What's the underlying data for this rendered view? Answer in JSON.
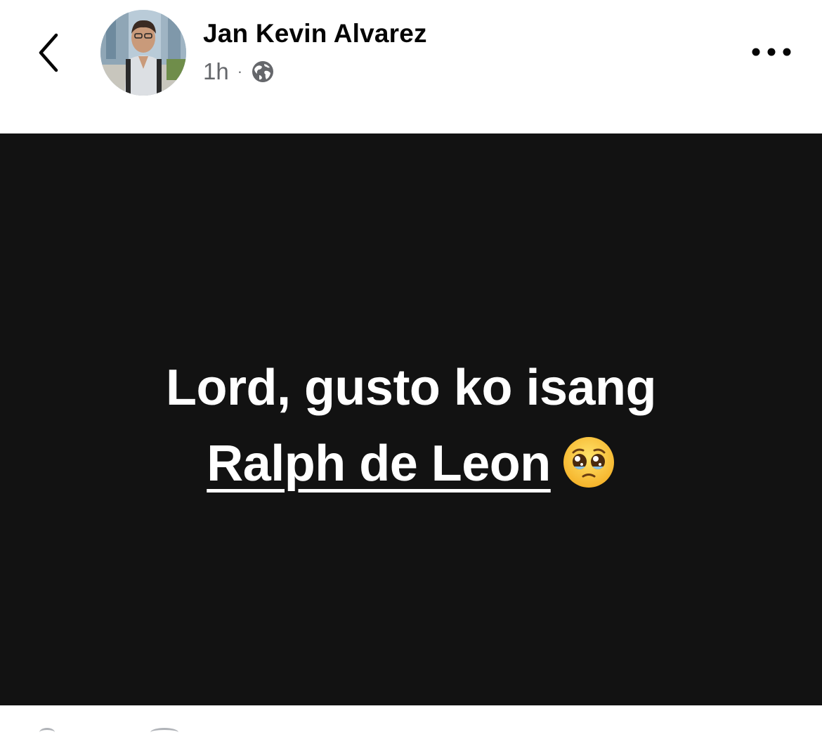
{
  "header": {
    "author_name": "Jan Kevin Alvarez",
    "time": "1h",
    "separator": "·",
    "audience_icon": "globe-icon",
    "back_icon": "chevron-left-icon",
    "more_icon": "more-horizontal-icon"
  },
  "post": {
    "background_color": "#121212",
    "text_color": "#ffffff",
    "line1": "Lord, gusto ko isang",
    "mention": "Ralph de Leon",
    "emoji_icon": "pleading-face-emoji"
  }
}
